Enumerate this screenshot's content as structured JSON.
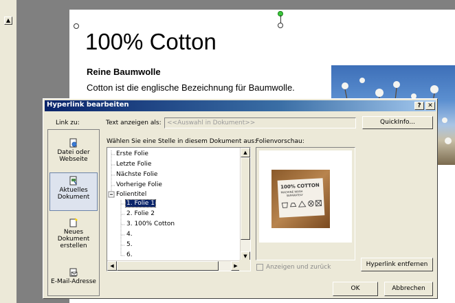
{
  "slide": {
    "title": "100% Cotton",
    "subheading": "Reine Baumwolle",
    "body": "Cotton ist die englische Bezeichnung für Baumwolle."
  },
  "dialog": {
    "title": "Hyperlink bearbeiten",
    "help_label": "?",
    "close_label": "✕",
    "link_to_label": "Link zu:",
    "display_text_label": "Text anzeigen als:",
    "display_text_value": "<<Auswahl in Dokument>>",
    "quickinfo_label": "QuickInfo...",
    "place_label": "Wählen Sie eine Stelle in diesem Dokument aus:",
    "preview_label": "Folienvorschau:",
    "link_items": [
      {
        "label": "Datei oder Webseite"
      },
      {
        "label": "Aktuelles Dokument"
      },
      {
        "label": "Neues Dokument erstellen"
      },
      {
        "label": "E-Mail-Adresse"
      }
    ],
    "tree_items": [
      "Erste Folie",
      "Letzte Folie",
      "Nächste Folie",
      "Vorherige Folie",
      "Folientitel",
      "1. Folie 1",
      "2. Folie 2",
      "3. 100% Cotton",
      "4.",
      "5.",
      "6."
    ],
    "show_and_return_label": "Anzeigen und zurück",
    "remove_link_label": "Hyperlink entfernen",
    "ok_label": "OK",
    "cancel_label": "Abbrechen",
    "preview_tag": {
      "line1": "100% COTTON",
      "line2": "MACHINE WASH",
      "line3": "SEPARATELY"
    }
  },
  "colors": {
    "titlebar_start": "#0a246a",
    "titlebar_end": "#a6caf0",
    "dialog_bg": "#ece9d8",
    "selection": "#0a246a"
  }
}
